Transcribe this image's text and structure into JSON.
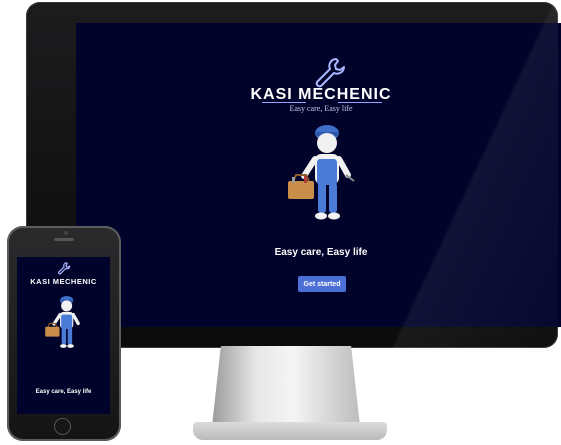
{
  "app": {
    "brand": "KASI MECHENIC",
    "tagline": "Easy care, Easy life",
    "slogan": "Easy care, Easy life",
    "cta_label": "Get started"
  },
  "icons": {
    "logo": "wrench-icon",
    "illustration": "mechanic-with-toolbox"
  },
  "colors": {
    "screen_background": "#02032a",
    "button": "#4b6fd4",
    "logo_accent": "#8fa3ff"
  },
  "devices": [
    "desktop-monitor",
    "smartphone"
  ]
}
